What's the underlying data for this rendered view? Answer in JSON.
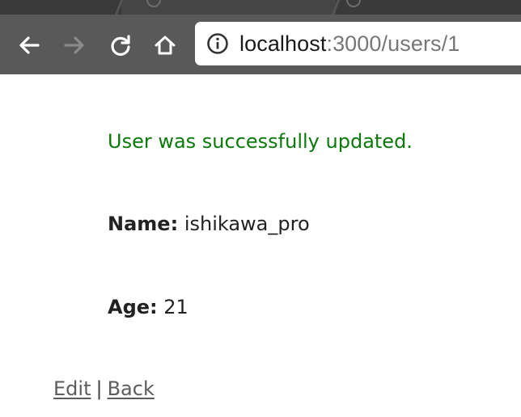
{
  "browser": {
    "colors": {
      "toolbar": "#595959",
      "tabstrip": "#3a3a3a",
      "icon": "#ffffff",
      "icon_disabled": "#8a8a8a"
    },
    "nav": {
      "back_icon": "arrow-left-icon",
      "forward_icon": "arrow-right-icon",
      "reload_icon": "reload-icon",
      "home_icon": "home-icon"
    },
    "address_bar": {
      "info_icon": "info-circle-icon",
      "host": "localhost",
      "path": ":3000/users/1"
    }
  },
  "page": {
    "notice": "User was successfully updated.",
    "notice_color": "#0a7a0a",
    "fields": {
      "name_label": "Name:",
      "name_value": "ishikawa_pro",
      "age_label": "Age:",
      "age_value": "21"
    },
    "links": {
      "edit": "Edit",
      "separator": "|",
      "back": "Back"
    }
  }
}
